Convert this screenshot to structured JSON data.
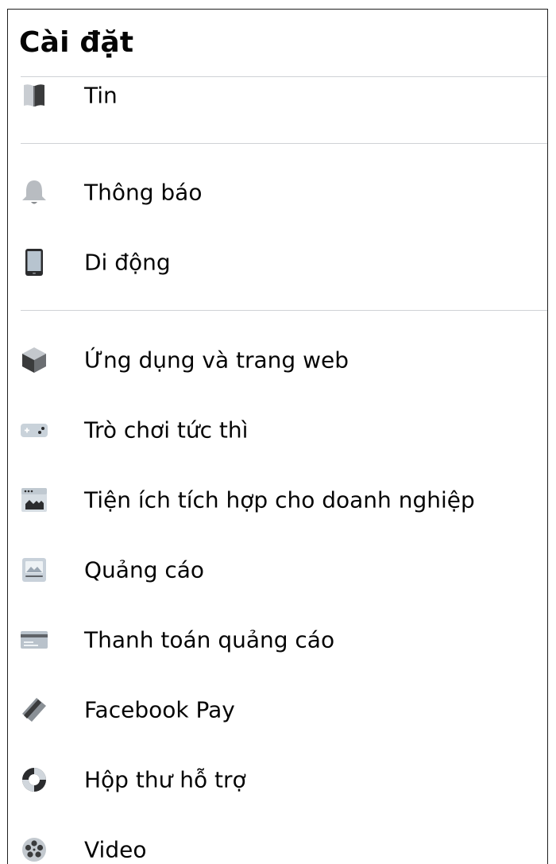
{
  "header": {
    "title": "Cài đặt"
  },
  "sections": [
    {
      "items": [
        {
          "label": "Tin",
          "icon": "book-icon"
        }
      ]
    },
    {
      "items": [
        {
          "label": "Thông báo",
          "icon": "bell-icon"
        },
        {
          "label": "Di động",
          "icon": "mobile-phone-icon"
        }
      ]
    },
    {
      "items": [
        {
          "label": "Ứng dụng và trang web",
          "icon": "cube-icon"
        },
        {
          "label": "Trò chơi tức thì",
          "icon": "gamepad-icon"
        },
        {
          "label": "Tiện ích tích hợp cho doanh nghiệp",
          "icon": "business-integration-icon"
        },
        {
          "label": "Quảng cáo",
          "icon": "ad-image-icon"
        },
        {
          "label": "Thanh toán quảng cáo",
          "icon": "credit-card-icon"
        },
        {
          "label": "Facebook Pay",
          "icon": "payment-tag-icon"
        },
        {
          "label": "Hộp thư hỗ trợ",
          "icon": "lifebuoy-icon"
        },
        {
          "label": "Video",
          "icon": "film-reel-icon"
        }
      ]
    }
  ],
  "colors": {
    "text": "#050505",
    "divider": "#cfd2d6",
    "icon": "#65676b"
  }
}
